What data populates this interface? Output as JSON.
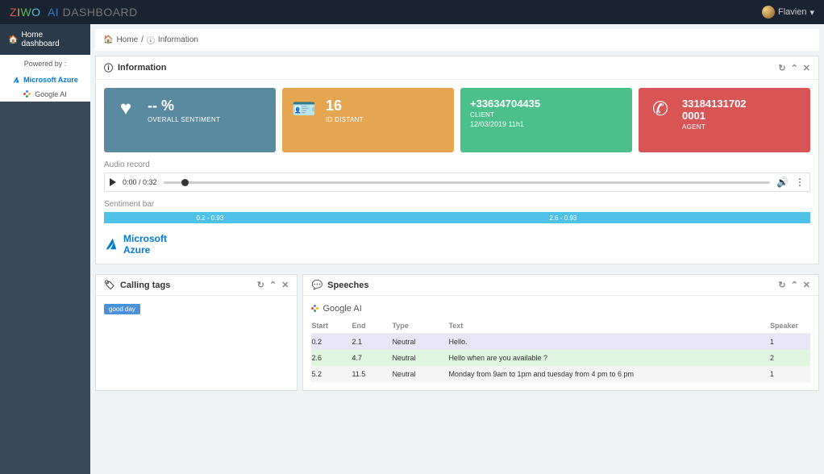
{
  "topbar": {
    "brand_prefix": "ZIWO",
    "brand_ai": "AI",
    "brand_suffix": "DASHBOARD",
    "user_name": "Flavien"
  },
  "sidebar": {
    "home_label": "Home dashboard",
    "powered_label": "Powered by :",
    "azure_label": "Microsoft Azure",
    "gai_label": "Google AI"
  },
  "breadcrumb": {
    "home": "Home",
    "sep": "/",
    "info": "Information"
  },
  "info_panel": {
    "title": "Information",
    "cards": {
      "sentiment": {
        "value": "-- %",
        "label": "OVERALL SENTIMENT"
      },
      "distant": {
        "value": "16",
        "label": "ID DISTANT"
      },
      "client": {
        "value": "+33634704435",
        "label": "CLIENT",
        "date": "12/03/2019 11h1"
      },
      "agent": {
        "value": "33184131702",
        "value2": "0001",
        "label": "AGENT"
      }
    },
    "audio": {
      "section": "Audio record",
      "time": "0:00 / 0:32"
    },
    "sentiment_bar": {
      "section": "Sentiment bar",
      "seg1": "0.2 - 0.93",
      "seg2": "2.6 - 0.93"
    },
    "azure_badge": "Microsoft\nAzure"
  },
  "calling_tags": {
    "title": "Calling tags",
    "tag1": "good day"
  },
  "speeches": {
    "title": "Speeches",
    "gai": "Google AI",
    "headers": {
      "start": "Start",
      "end": "End",
      "type": "Type",
      "text": "Text",
      "speaker": "Speaker"
    },
    "rows": [
      {
        "start": "0.2",
        "end": "2.1",
        "type": "Neutral",
        "text": "Hello.",
        "speaker": "1"
      },
      {
        "start": "2.6",
        "end": "4.7",
        "type": "Neutral",
        "text": "Hello when are you available ?",
        "speaker": "2"
      },
      {
        "start": "5.2",
        "end": "11.5",
        "type": "Neutral",
        "text": "Monday from 9am to 1pm and tuesday from 4 pm to 6 pm",
        "speaker": "1"
      }
    ]
  }
}
